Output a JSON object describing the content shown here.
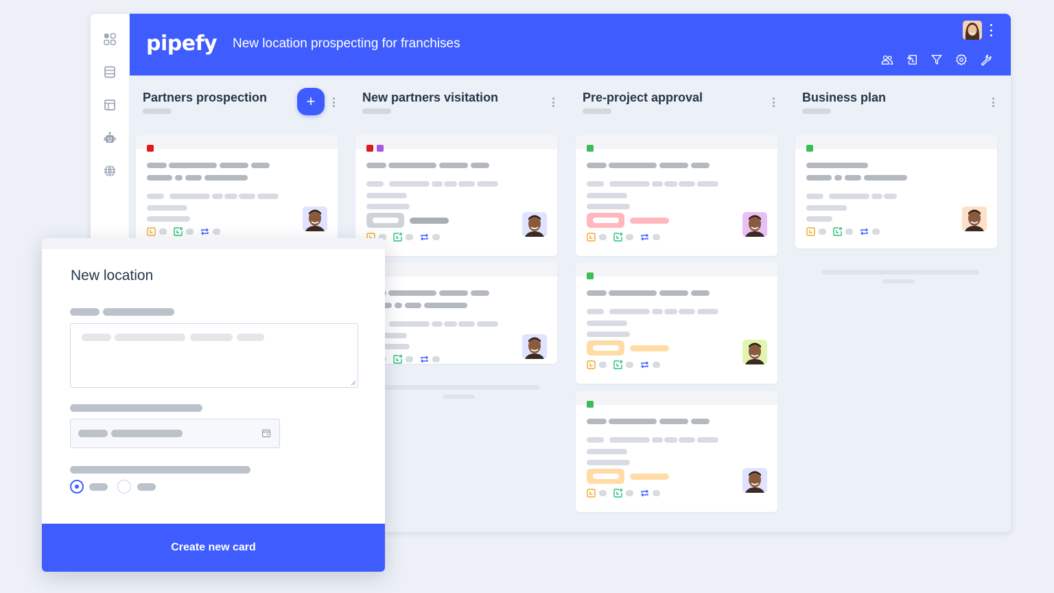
{
  "app": {
    "logo": "pipefy",
    "pipe_title": "New location prospecting for franchises",
    "colors": {
      "brand": "#3f5cff",
      "background": "#edf1f7",
      "title_text": "#263548"
    }
  },
  "sidebar": {
    "items": [
      {
        "icon": "apps-grid-icon"
      },
      {
        "icon": "database-icon"
      },
      {
        "icon": "layout-icon"
      },
      {
        "icon": "robot-icon"
      },
      {
        "icon": "globe-icon"
      }
    ]
  },
  "topbar": {
    "user_avatar": "user-avatar",
    "tools": [
      "members-icon",
      "import-icon",
      "filter-icon",
      "settings-icon",
      "wrench-icon"
    ]
  },
  "columns": [
    {
      "title": "Partners prospection",
      "has_add_button": true,
      "add_label": "+",
      "cards": [
        {
          "tags": [
            "#e0191b"
          ],
          "avatar_bg": "#dfe3ff",
          "badge": null
        }
      ]
    },
    {
      "title": "New partners visitation",
      "has_add_button": false,
      "cards": [
        {
          "tags": [
            "#e0191b",
            "#a855e6"
          ],
          "avatar_bg": "#dfe3ff",
          "badge": "gray"
        },
        {
          "tags": [],
          "avatar_bg": "#dfe3ff",
          "badge": null
        }
      ]
    },
    {
      "title": "Pre-project approval",
      "has_add_button": false,
      "cards": [
        {
          "tags": [
            "#3dbd55"
          ],
          "avatar_bg": "#e8c0f5",
          "badge": "red"
        },
        {
          "tags": [
            "#3dbd55"
          ],
          "avatar_bg": "#e2f5b0",
          "badge": "orange"
        },
        {
          "tags": [
            "#3dbd55"
          ],
          "avatar_bg": "#dfe3ff",
          "badge": "orange"
        }
      ]
    },
    {
      "title": "Business plan",
      "has_add_button": false,
      "cards": [
        {
          "tags": [
            "#3dbd55"
          ],
          "avatar_bg": "#fde0c7",
          "badge": null
        }
      ]
    }
  ],
  "badge_colors": {
    "gray": {
      "box": "#cfd3d9",
      "line": "#a9aeb5"
    },
    "red": {
      "box": "#ffb8bd",
      "line": "#ffb8bd"
    },
    "orange": {
      "box": "#ffdba6",
      "line": "#ffdba6"
    }
  },
  "card_icon_colors": {
    "due": "#f5a524",
    "sla": "#22c07a",
    "repeat": "#3f5cff"
  },
  "modal": {
    "title": "New location",
    "submit_label": "Create new card",
    "radio_selected_index": 0
  }
}
